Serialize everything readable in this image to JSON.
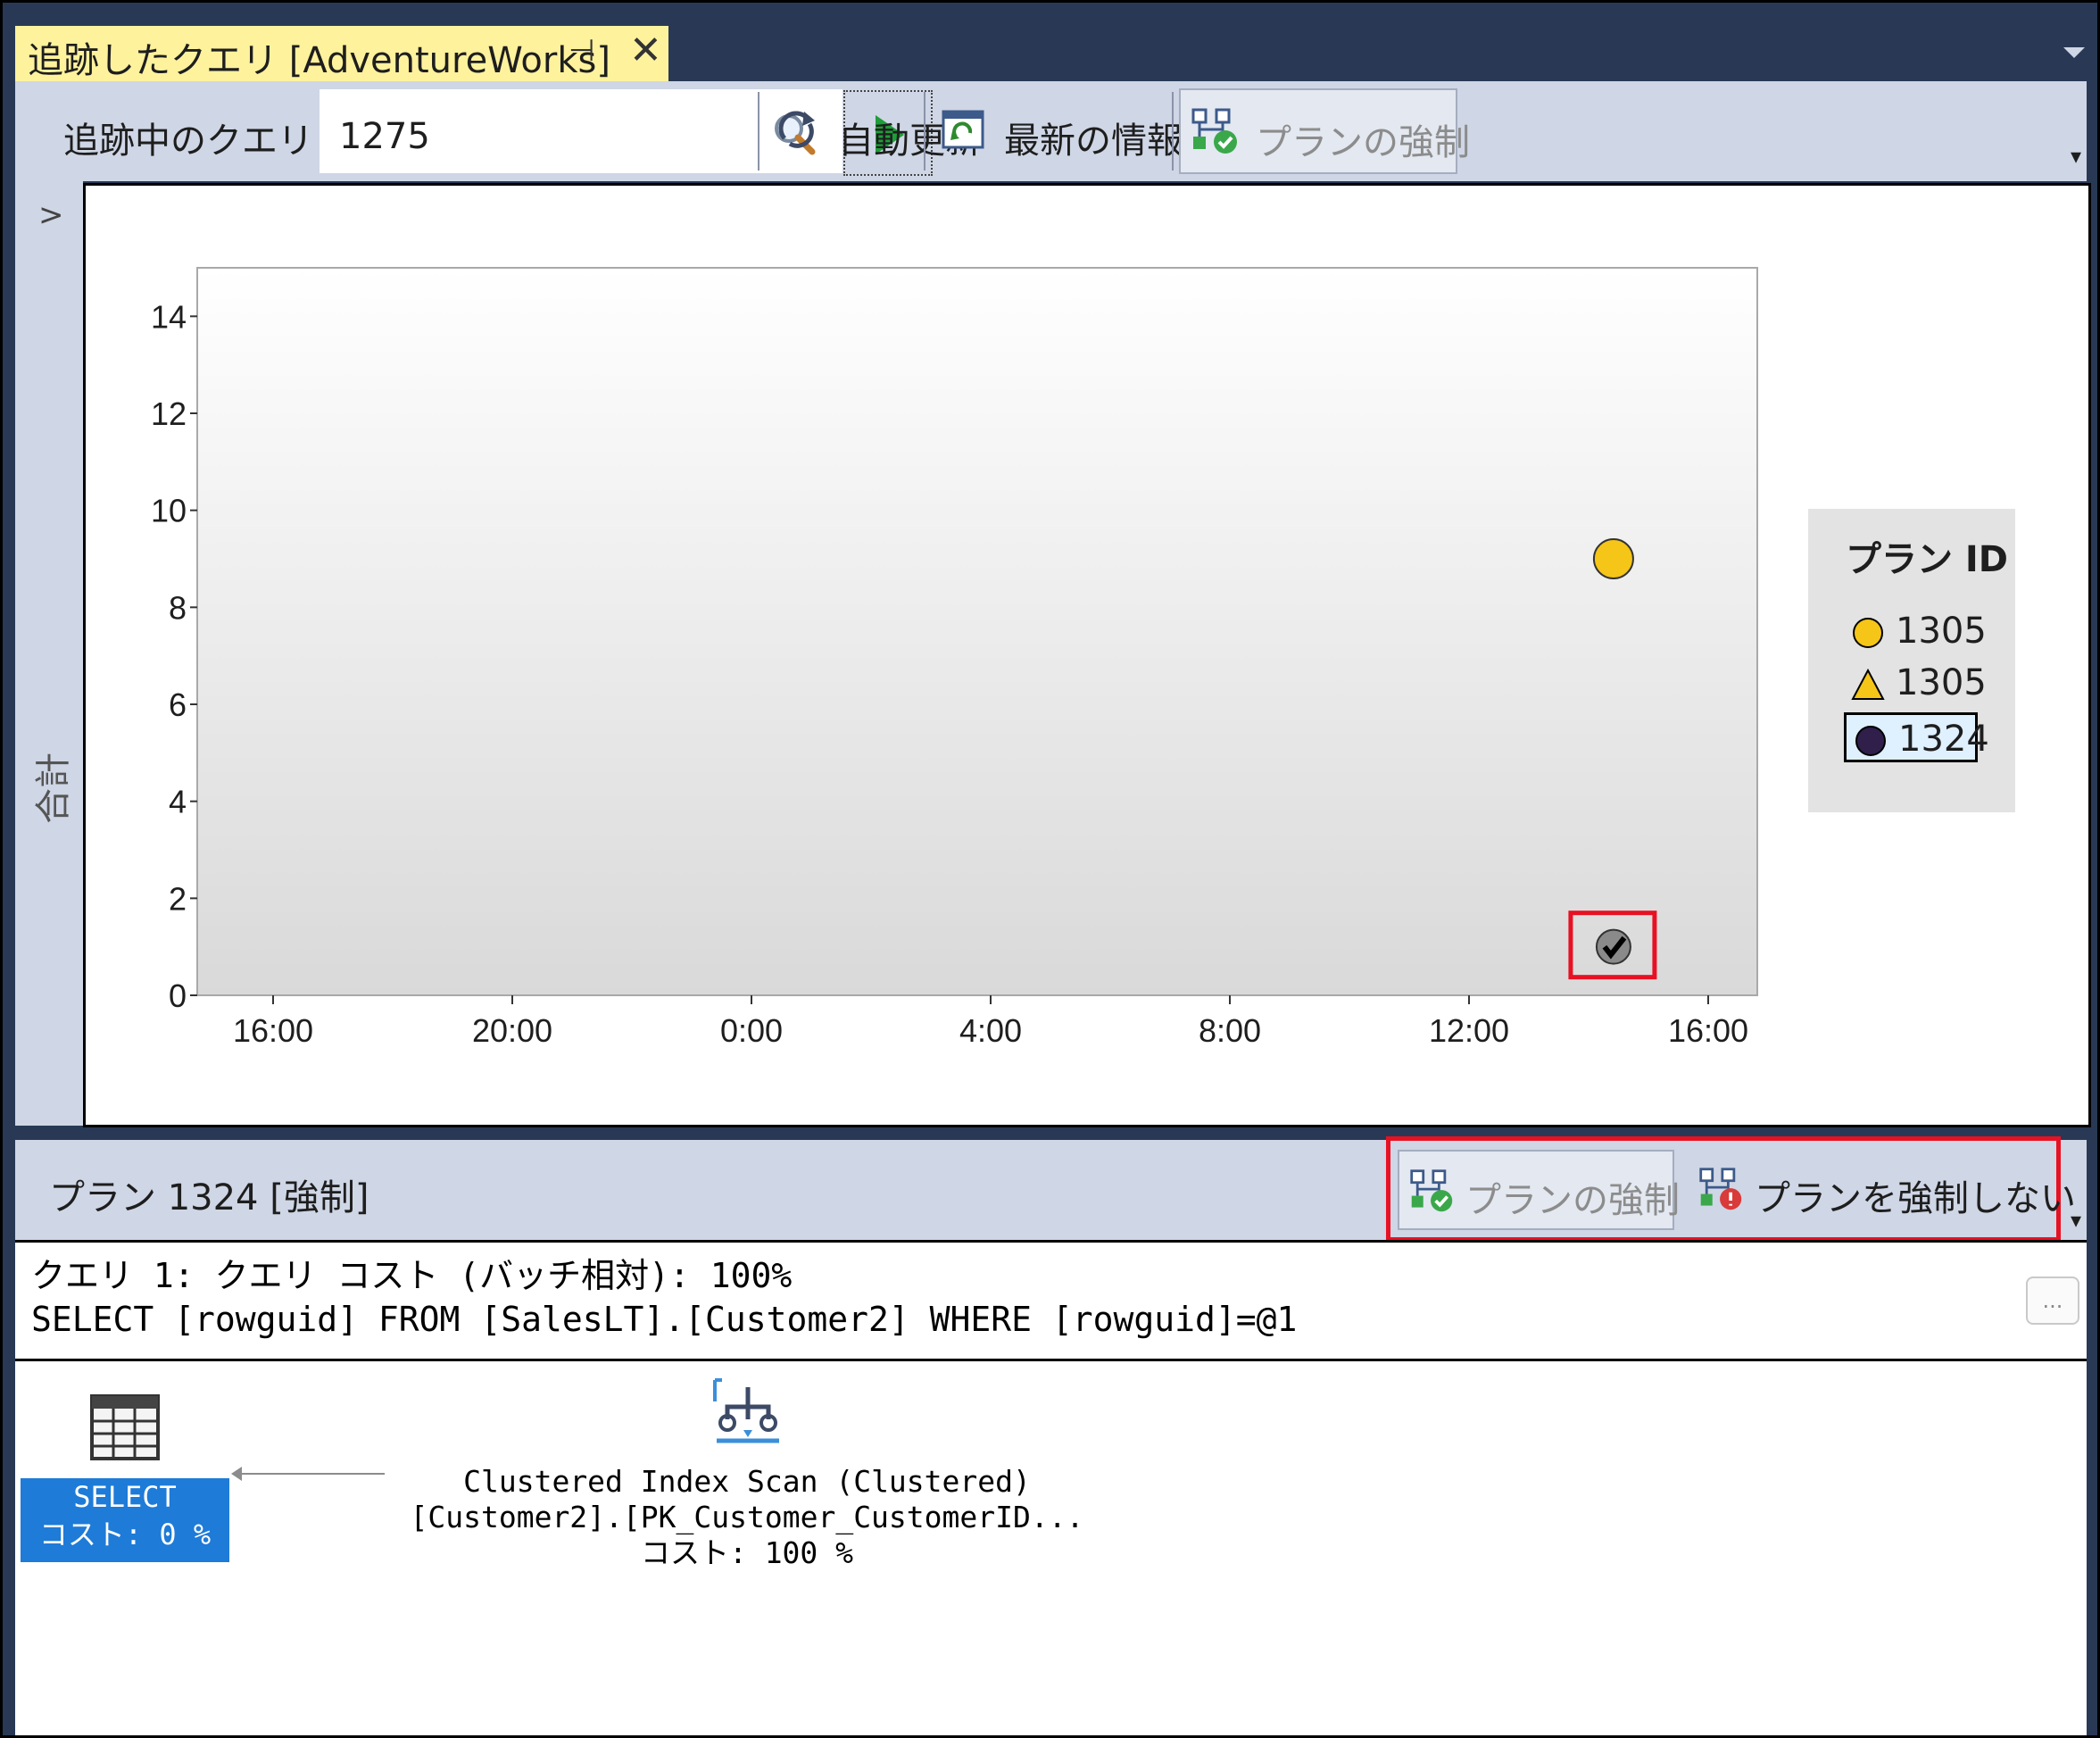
{
  "tab": {
    "title": "追跡したクエリ [AdventureWorks]",
    "pin_glyph": "⊣",
    "close_glyph": "✕"
  },
  "toolbar": {
    "query_label": "追跡中のクエリ",
    "query_value": "1275",
    "auto_refresh": "自動更新",
    "refresh": "最新の情報に更新",
    "force_plan": "プランの強制"
  },
  "sidebar": {
    "chevron": ">",
    "label": "合計"
  },
  "chart_data": {
    "type": "scatter",
    "ylabel": "合計",
    "ylim": [
      0,
      15
    ],
    "y_ticks": [
      "0",
      "2",
      "4",
      "6",
      "8",
      "10",
      "12",
      "14"
    ],
    "x_ticks": [
      "16:00",
      "20:00",
      "0:00",
      "4:00",
      "8:00",
      "12:00",
      "16:00"
    ],
    "legend_title": "プラン ID",
    "series": [
      {
        "name": "1305",
        "marker": "circle",
        "color": "#f5c518",
        "points": [
          {
            "x": "14:25",
            "y": 9
          }
        ]
      },
      {
        "name": "1305",
        "marker": "triangle",
        "color": "#f5c518",
        "points": []
      },
      {
        "name": "1324",
        "marker": "circle",
        "color": "#2f1f4a",
        "forced": true,
        "points": [
          {
            "x": "14:25",
            "y": 1
          }
        ]
      }
    ]
  },
  "plan": {
    "title": "プラン 1324 [強制]",
    "force_button": "プランの強制",
    "unforce_button": "プランを強制しない",
    "query_cost_line": "クエリ 1: クエリ コスト (バッチ相対): 100%",
    "sql_line": "SELECT [rowguid] FROM [SalesLT].[Customer2] WHERE [rowguid]=@1",
    "ellipsis": "...",
    "select_node": {
      "title": "SELECT",
      "cost": "コスト: 0 %"
    },
    "scan_node": {
      "line1": "Clustered Index Scan (Clustered)",
      "line2": "[Customer2].[PK_Customer_CustomerID...",
      "cost": "コスト: 100 %"
    }
  },
  "colors": {
    "accent_red": "#e81123",
    "tab_yellow": "#fff29d",
    "toolbar_bg": "#cfd6e5",
    "select_blue": "#1e7bd8"
  }
}
